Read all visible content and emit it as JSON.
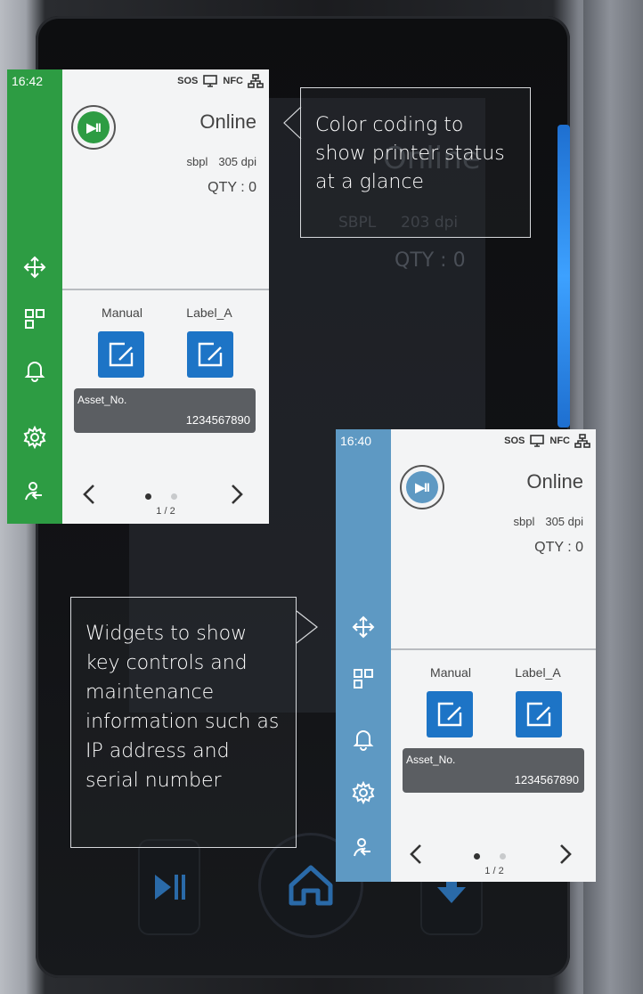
{
  "colors": {
    "online_green": "#2d9c43",
    "standby_blue": "#5e99c3",
    "widget_blue": "#1d74c6",
    "asset_gray": "#5b5e62"
  },
  "callouts": {
    "status_colors": "Color coding to show printer status at a glance",
    "widgets": "Widgets to show key controls and maintenance information such as IP address and serial number"
  },
  "background_screen": {
    "status": "Online",
    "language": "SBPL",
    "resolution": "203 dpi",
    "quantity": "QTY : 0"
  },
  "panels": [
    {
      "state": "online",
      "rail_color": "#2d9c43",
      "time": "16:42",
      "status_icons": [
        "sos-icon",
        "monitor-icon",
        "nfc-icon",
        "network-icon"
      ],
      "sos_label": "SOS",
      "nfc_label": "NFC",
      "play_label": "▶II",
      "status": "Online",
      "language": "sbpl",
      "resolution": "305 dpi",
      "quantity": "QTY : 0",
      "nav": [
        "move-icon",
        "widgets-grid-icon",
        "bell-icon",
        "gear-icon",
        "user-logout-icon"
      ],
      "widgets": [
        {
          "label": "Manual",
          "icon": "edit-icon"
        },
        {
          "label": "Label_A",
          "icon": "edit-icon"
        }
      ],
      "asset": {
        "name": "Asset_No.",
        "value": "1234567890"
      },
      "pager": {
        "current": 1,
        "total": 2,
        "label": "1 / 2"
      }
    },
    {
      "state": "paused",
      "rail_color": "#5e99c3",
      "time": "16:40",
      "status_icons": [
        "sos-icon",
        "monitor-icon",
        "nfc-icon",
        "network-icon"
      ],
      "sos_label": "SOS",
      "nfc_label": "NFC",
      "play_label": "▶II",
      "status": "Online",
      "language": "sbpl",
      "resolution": "305 dpi",
      "quantity": "QTY : 0",
      "nav": [
        "move-icon",
        "widgets-grid-icon",
        "bell-icon",
        "gear-icon",
        "user-logout-icon"
      ],
      "widgets": [
        {
          "label": "Manual",
          "icon": "edit-icon"
        },
        {
          "label": "Label_A",
          "icon": "edit-icon"
        }
      ],
      "asset": {
        "name": "Asset_No.",
        "value": "1234567890"
      },
      "pager": {
        "current": 1,
        "total": 2,
        "label": "1 / 2"
      }
    }
  ]
}
